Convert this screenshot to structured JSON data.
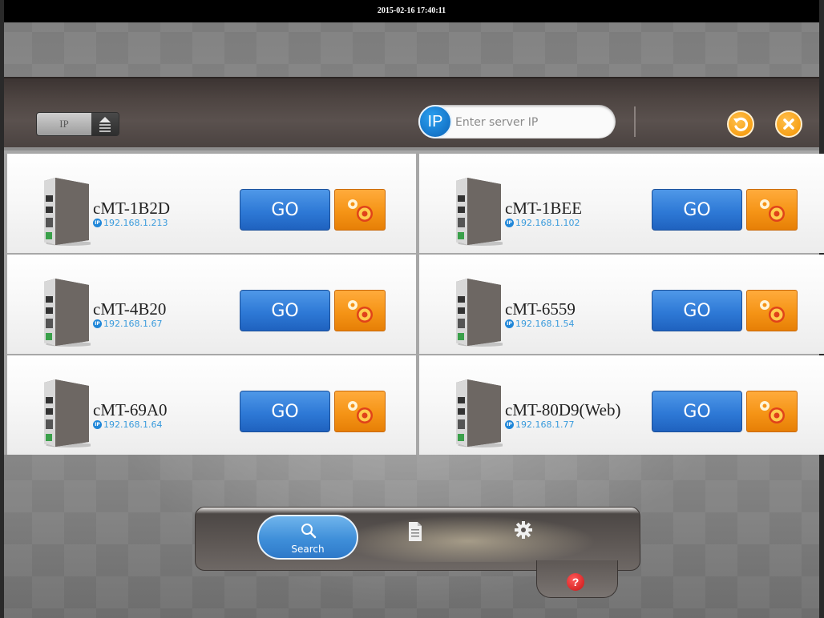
{
  "status_bar": {
    "datetime": "2015-02-16 17:40:11"
  },
  "toolbar": {
    "mode_toggle_label": "IP",
    "server_ip": {
      "badge": "IP",
      "placeholder": "Enter server IP",
      "value": ""
    },
    "refresh_icon": "refresh-icon",
    "close_icon": "close-icon"
  },
  "devices": [
    {
      "name": "cMT-1B2D",
      "ip_badge": "IP",
      "ip": "192.168.1.213",
      "go_label": "GO"
    },
    {
      "name": "cMT-1BEE",
      "ip_badge": "IP",
      "ip": "192.168.1.102",
      "go_label": "GO"
    },
    {
      "name": "cMT-4B20",
      "ip_badge": "IP",
      "ip": "192.168.1.67",
      "go_label": "GO"
    },
    {
      "name": "cMT-6559",
      "ip_badge": "IP",
      "ip": "192.168.1.54",
      "go_label": "GO"
    },
    {
      "name": "cMT-69A0",
      "ip_badge": "IP",
      "ip": "192.168.1.64",
      "go_label": "GO"
    },
    {
      "name": "cMT-80D9(Web)",
      "ip_badge": "IP",
      "ip": "192.168.1.77",
      "go_label": "GO"
    }
  ],
  "bottom_nav": {
    "search_label": "Search",
    "active_tab": "search",
    "help_symbol": "?"
  },
  "colors": {
    "go_blue": "#2e79d6",
    "settings_orange": "#f59416",
    "ip_blue": "#1f86d8",
    "help_red": "#c81212"
  }
}
